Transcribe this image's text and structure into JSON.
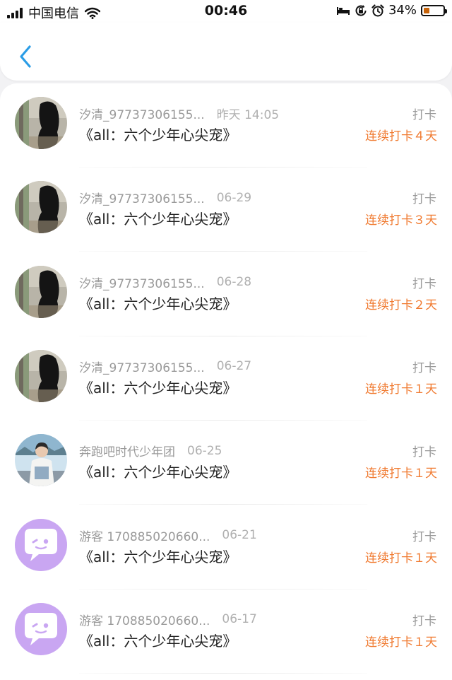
{
  "status_bar": {
    "carrier": "中国电信",
    "time": "00:46",
    "battery": "34%"
  },
  "colors": {
    "accent": "#2b9de6",
    "streak": "#f07a30",
    "guest_avatar": "#c9a6f2"
  },
  "records": [
    {
      "avatar": "photo-hair",
      "name": "汐清_97737306155...",
      "date": "昨天 14:05",
      "book": "《all：六个少年心尖宠》",
      "type": "打卡",
      "streak": "连续打卡４天"
    },
    {
      "avatar": "photo-hair",
      "name": "汐清_97737306155...",
      "date": "06-29",
      "book": "《all：六个少年心尖宠》",
      "type": "打卡",
      "streak": "连续打卡３天"
    },
    {
      "avatar": "photo-hair",
      "name": "汐清_97737306155...",
      "date": "06-28",
      "book": "《all：六个少年心尖宠》",
      "type": "打卡",
      "streak": "连续打卡２天"
    },
    {
      "avatar": "photo-hair",
      "name": "汐清_97737306155...",
      "date": "06-27",
      "book": "《all：六个少年心尖宠》",
      "type": "打卡",
      "streak": "连续打卡１天"
    },
    {
      "avatar": "photo-boy",
      "name": "奔跑吧时代少年团",
      "date": "06-25",
      "book": "《all：六个少年心尖宠》",
      "type": "打卡",
      "streak": "连续打卡１天"
    },
    {
      "avatar": "guest",
      "name": "游客 170885020660...",
      "date": "06-21",
      "book": "《all：六个少年心尖宠》",
      "type": "打卡",
      "streak": "连续打卡１天"
    },
    {
      "avatar": "guest",
      "name": "游客 170885020660...",
      "date": "06-17",
      "book": "《all：六个少年心尖宠》",
      "type": "打卡",
      "streak": "连续打卡１天"
    }
  ]
}
